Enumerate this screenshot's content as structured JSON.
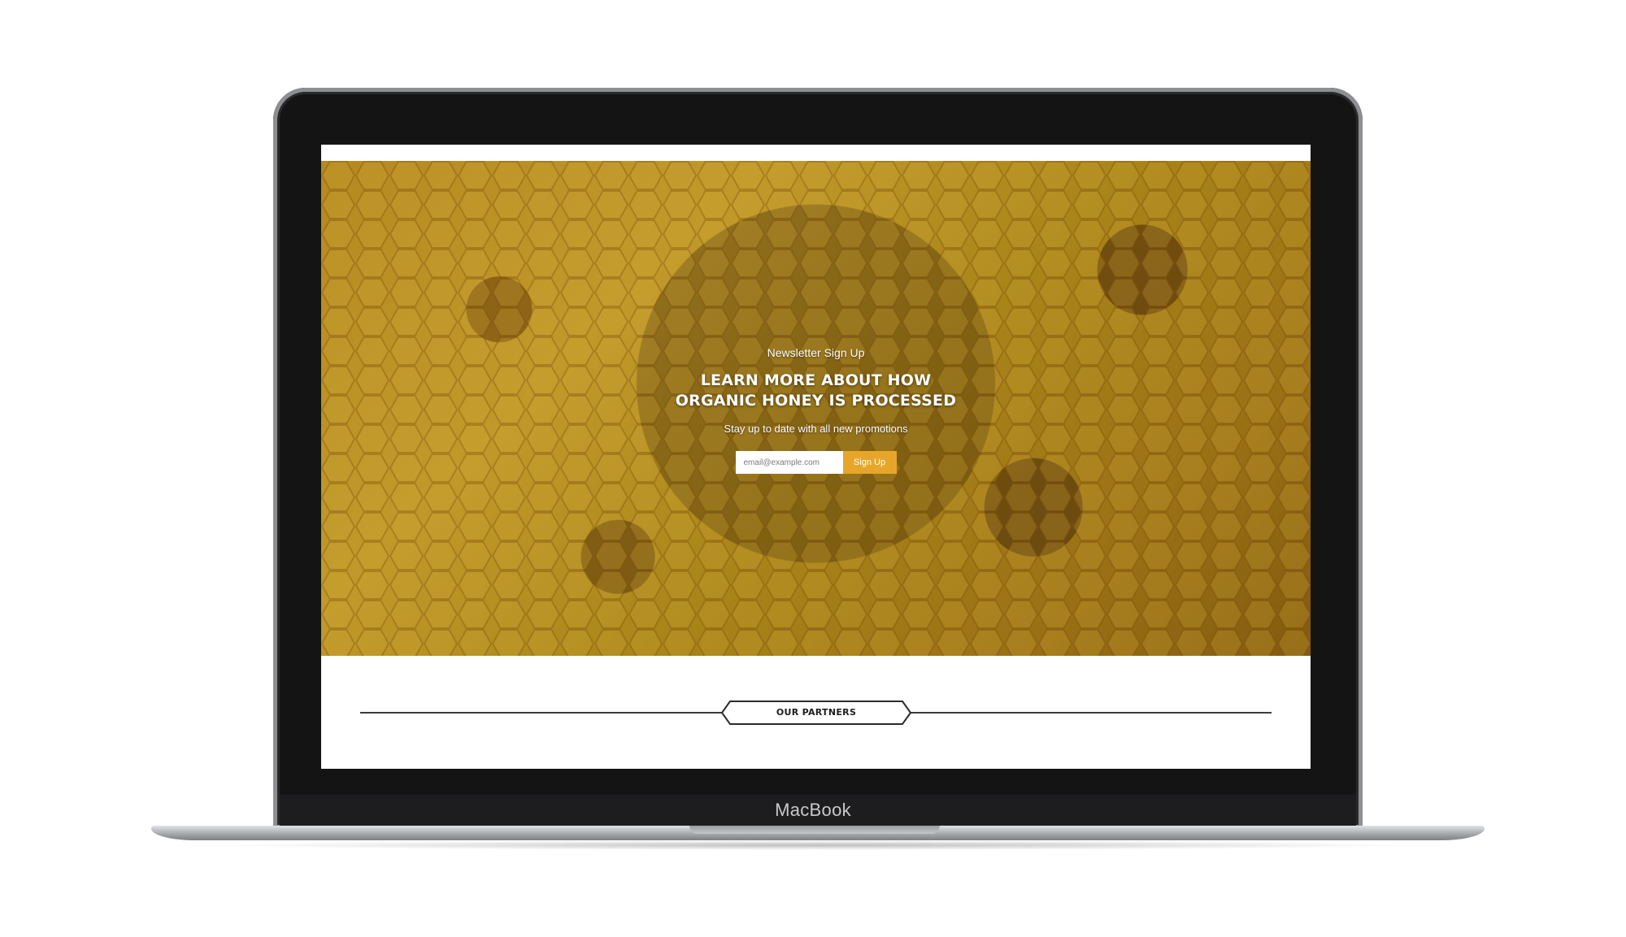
{
  "device": {
    "brand_label": "MacBook"
  },
  "hero": {
    "eyebrow": "Newsletter Sign Up",
    "headline": "LEARN MORE ABOUT HOW ORGANIC HONEY IS PROCESSED",
    "subline": "Stay up to date with all new promotions",
    "email_placeholder": "email@example.com",
    "button_label": "Sign Up",
    "button_color": "#e7a62a",
    "background_image": "honeycomb-with-bees"
  },
  "partners": {
    "label": "OUR PARTNERS"
  }
}
